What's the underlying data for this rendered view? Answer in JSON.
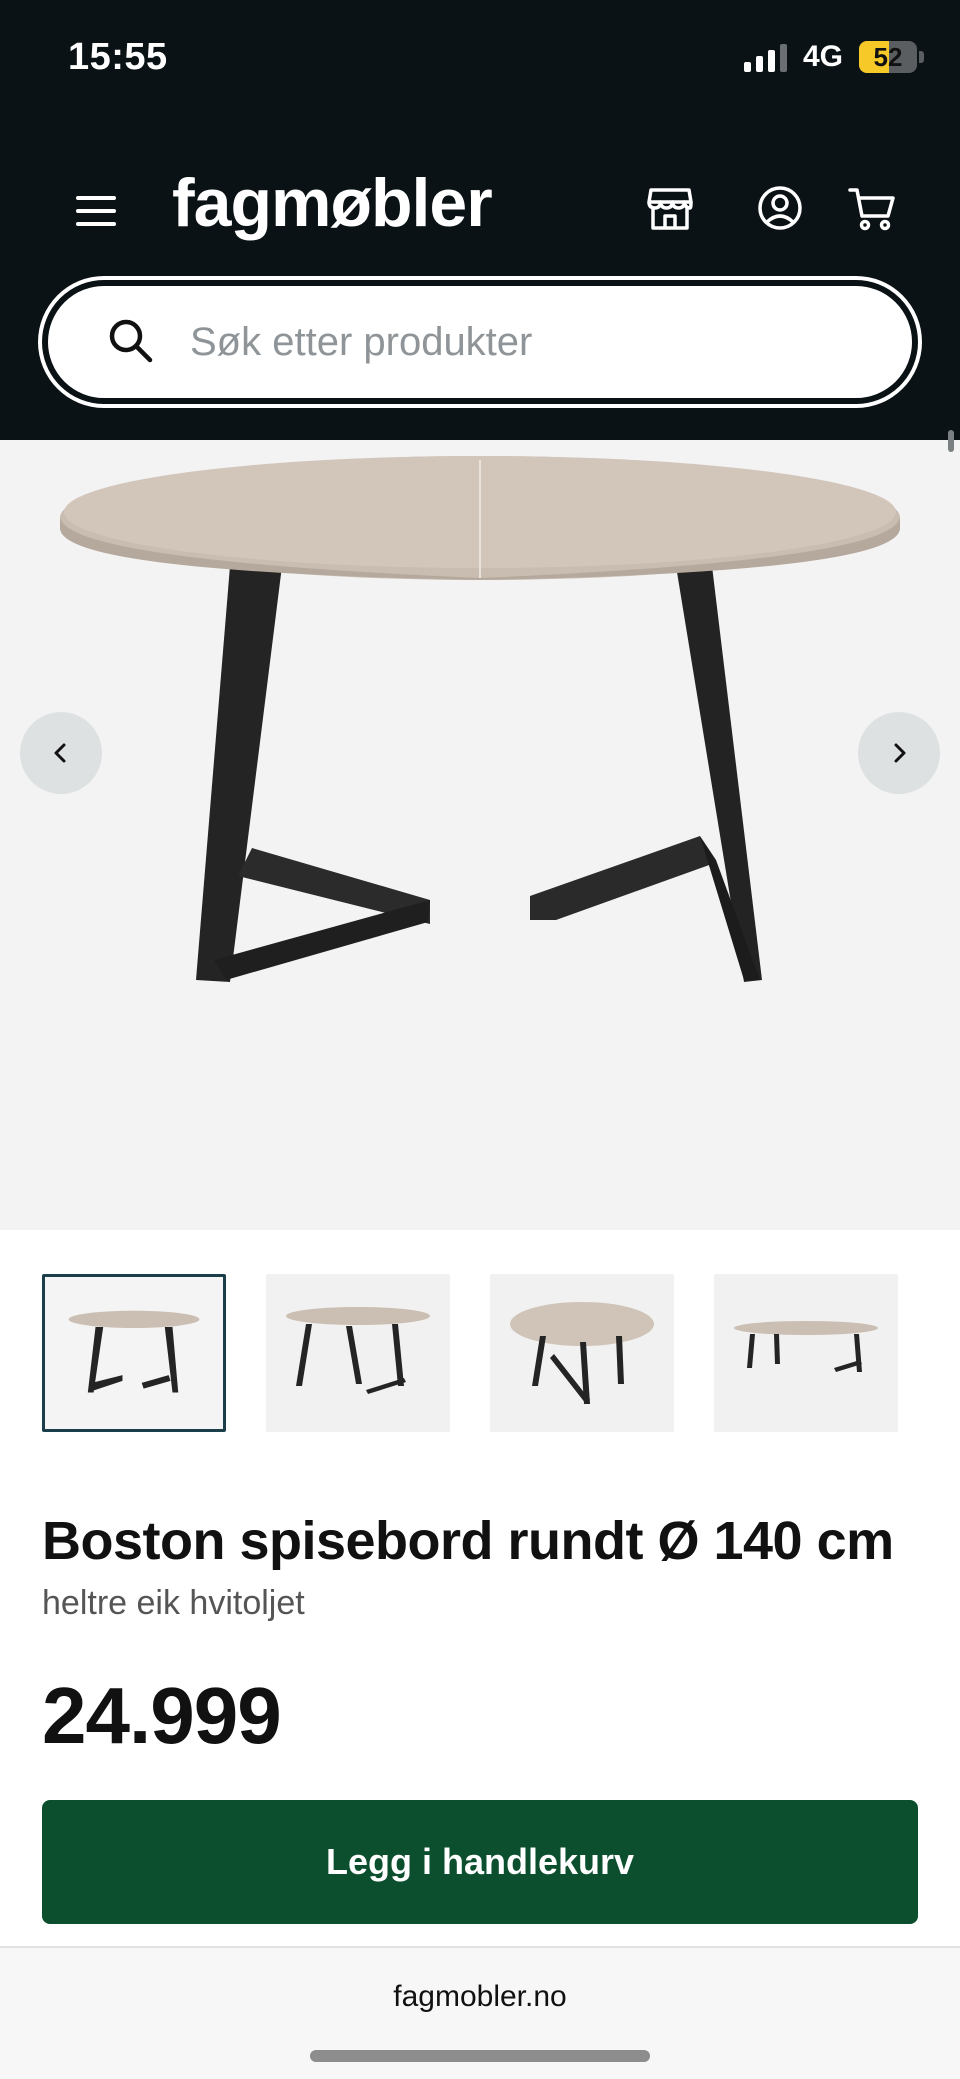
{
  "status_bar": {
    "time": "15:55",
    "network": "4G",
    "battery": "52",
    "battery_level": 0.52
  },
  "header": {
    "logo": "fagmøbler",
    "icons": [
      "menu-icon",
      "store-icon",
      "account-icon",
      "cart-icon"
    ],
    "background_color": "#0b1216"
  },
  "search": {
    "placeholder": "Søk etter produkter",
    "value": ""
  },
  "gallery": {
    "thumbnail_count": 4,
    "active_thumbnail": 1,
    "prev_icon": "chevron-left-icon",
    "next_icon": "chevron-right-icon"
  },
  "product": {
    "title": "Boston spisebord rundt Ø 140 cm",
    "variant": "heltre eik hvitoljet",
    "price": "24.999"
  },
  "cta": {
    "label": "Legg i handlekurv",
    "color": "#0b4f2e"
  },
  "browser": {
    "url": "fagmobler.no"
  }
}
